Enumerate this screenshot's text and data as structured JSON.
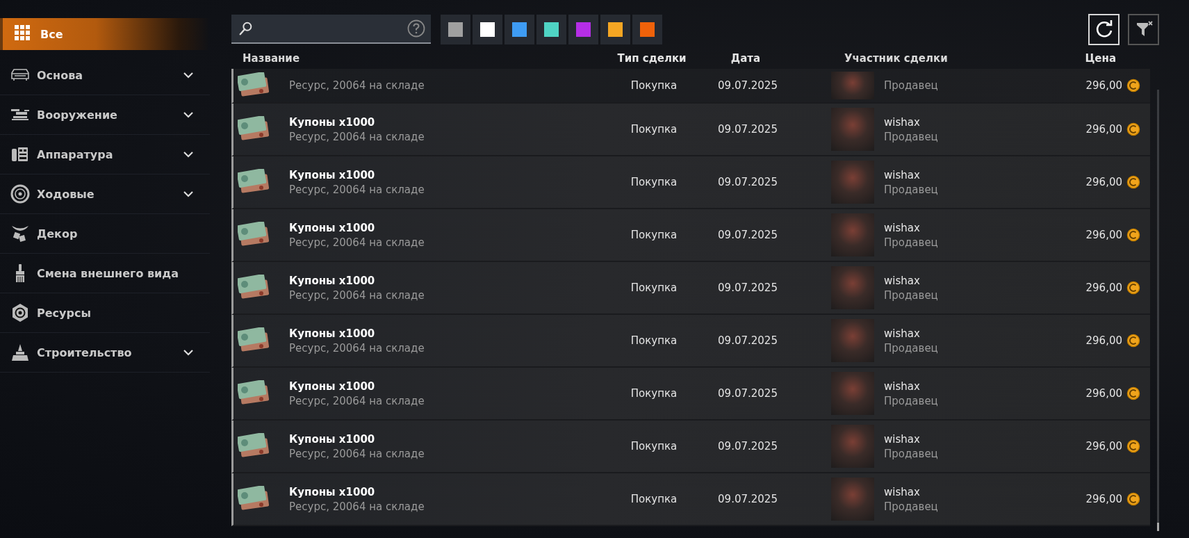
{
  "sidebar": {
    "items": [
      {
        "label": "Все",
        "expandable": false,
        "selected": true
      },
      {
        "label": "Основа",
        "expandable": true,
        "selected": false
      },
      {
        "label": "Вооружение",
        "expandable": true,
        "selected": false
      },
      {
        "label": "Аппаратура",
        "expandable": true,
        "selected": false
      },
      {
        "label": "Ходовые",
        "expandable": true,
        "selected": false
      },
      {
        "label": "Декор",
        "expandable": false,
        "selected": false
      },
      {
        "label": "Смена внешнего вида",
        "expandable": false,
        "selected": false
      },
      {
        "label": "Ресурсы",
        "expandable": false,
        "selected": false
      },
      {
        "label": "Строительство",
        "expandable": true,
        "selected": false
      }
    ]
  },
  "rarity_filters": [
    {
      "color": "#a0a0a0"
    },
    {
      "color": "#ffffff"
    },
    {
      "color": "#3e9cf4"
    },
    {
      "color": "#4fd4c4"
    },
    {
      "color": "#b52ee6"
    },
    {
      "color": "#f5a623"
    },
    {
      "color": "#f0620a"
    }
  ],
  "table": {
    "columns": [
      "Название",
      "Тип сделки",
      "Дата",
      "Участник сделки",
      "Цена"
    ],
    "rows": [
      {
        "kind": "partial",
        "detail": "Ресурс, 20064 на складе",
        "deal_type": "Покупка",
        "date": "09.07.2025",
        "role": "Продавец",
        "price": "296,00"
      },
      {
        "kind": "full",
        "name": "Купоны x1000",
        "detail": "Ресурс, 20064 на складе",
        "deal_type": "Покупка",
        "date": "09.07.2025",
        "player": "wishax",
        "role": "Продавец",
        "price": "296,00"
      },
      {
        "kind": "full",
        "name": "Купоны x1000",
        "detail": "Ресурс, 20064 на складе",
        "deal_type": "Покупка",
        "date": "09.07.2025",
        "player": "wishax",
        "role": "Продавец",
        "price": "296,00"
      },
      {
        "kind": "full",
        "name": "Купоны x1000",
        "detail": "Ресурс, 20064 на складе",
        "deal_type": "Покупка",
        "date": "09.07.2025",
        "player": "wishax",
        "role": "Продавец",
        "price": "296,00"
      },
      {
        "kind": "full",
        "name": "Купоны x1000",
        "detail": "Ресурс, 20064 на складе",
        "deal_type": "Покупка",
        "date": "09.07.2025",
        "player": "wishax",
        "role": "Продавец",
        "price": "296,00"
      },
      {
        "kind": "full",
        "name": "Купоны x1000",
        "detail": "Ресурс, 20064 на складе",
        "deal_type": "Покупка",
        "date": "09.07.2025",
        "player": "wishax",
        "role": "Продавец",
        "price": "296,00"
      },
      {
        "kind": "full",
        "name": "Купоны x1000",
        "detail": "Ресурс, 20064 на складе",
        "deal_type": "Покупка",
        "date": "09.07.2025",
        "player": "wishax",
        "role": "Продавец",
        "price": "296,00"
      },
      {
        "kind": "full",
        "name": "Купоны x1000",
        "detail": "Ресурс, 20064 на складе",
        "deal_type": "Покупка",
        "date": "09.07.2025",
        "player": "wishax",
        "role": "Продавец",
        "price": "296,00"
      },
      {
        "kind": "full",
        "name": "Купоны x1000",
        "detail": "Ресурс, 20064 на складе",
        "deal_type": "Покупка",
        "date": "09.07.2025",
        "player": "wishax",
        "role": "Продавец",
        "price": "296,00"
      }
    ]
  }
}
